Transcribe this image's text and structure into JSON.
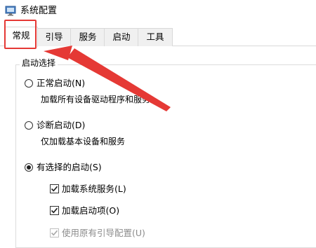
{
  "window": {
    "title": "系统配置",
    "icon": "system-config-icon"
  },
  "tabs": [
    {
      "label": "常规",
      "active": true
    },
    {
      "label": "引导",
      "active": false
    },
    {
      "label": "服务",
      "active": false
    },
    {
      "label": "启动",
      "active": false
    },
    {
      "label": "工具",
      "active": false
    }
  ],
  "startup_selection": {
    "legend": "启动选择",
    "options": [
      {
        "label": "正常启动(N)",
        "description": "加载所有设备驱动程序和服务",
        "selected": false
      },
      {
        "label": "诊断启动(D)",
        "description": "仅加载基本设备和服务",
        "selected": false
      },
      {
        "label": "有选择的启动(S)",
        "selected": true
      }
    ],
    "selective_items": [
      {
        "label": "加载系统服务(L)",
        "checked": true,
        "enabled": true
      },
      {
        "label": "加载启动项(O)",
        "checked": true,
        "enabled": true
      },
      {
        "label": "使用原有引导配置(U)",
        "checked": true,
        "enabled": false
      }
    ]
  },
  "annotation": {
    "color": "#e53935"
  }
}
